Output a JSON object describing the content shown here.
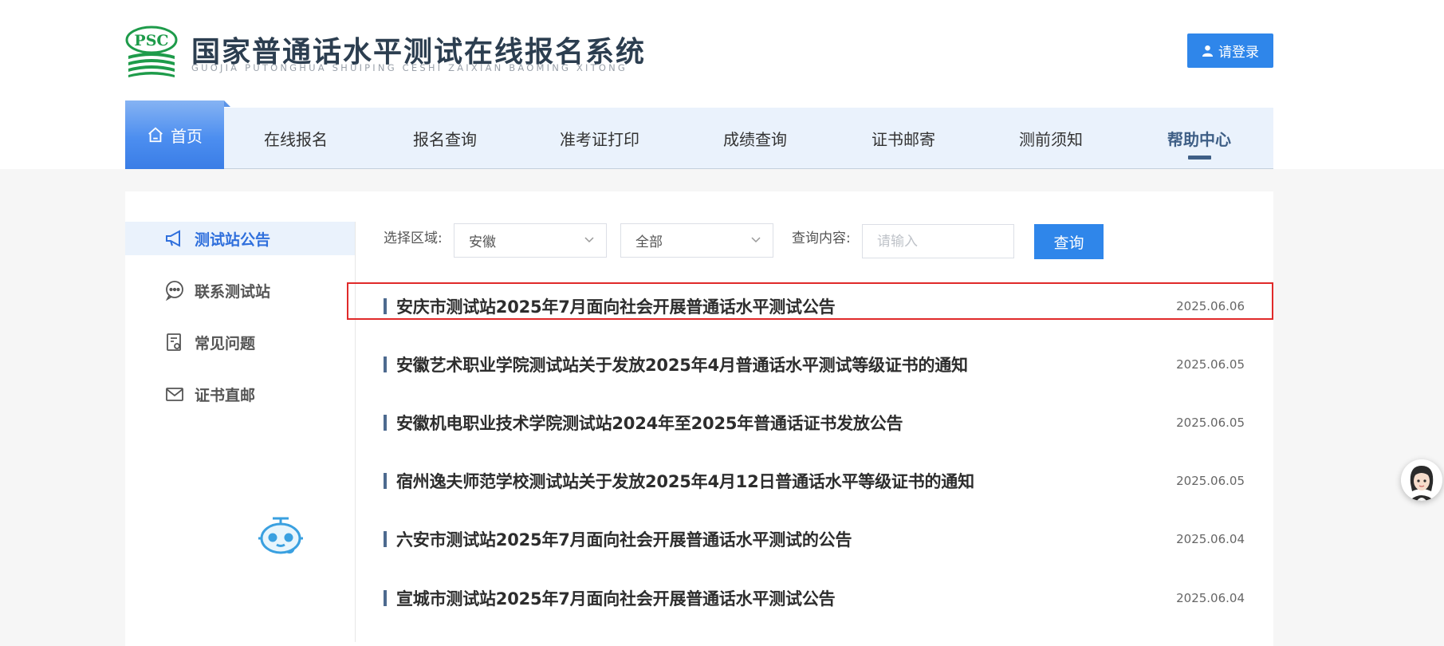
{
  "header": {
    "logo_text": "PSC",
    "title": "国家普通话水平测试在线报名系统",
    "subtitle": "GUOJIA PUTONGHUA SHUIPING CESHI ZAIXIAN BAOMING XITONG",
    "login_label": "请登录"
  },
  "nav": {
    "home": "首页",
    "items": [
      "在线报名",
      "报名查询",
      "准考证打印",
      "成绩查询",
      "证书邮寄",
      "测前须知",
      "帮助中心"
    ]
  },
  "sidebar": {
    "items": [
      {
        "label": "测试站公告",
        "icon": "megaphone-icon"
      },
      {
        "label": "联系测试站",
        "icon": "chat-icon"
      },
      {
        "label": "常见问题",
        "icon": "document-icon"
      },
      {
        "label": "证书直邮",
        "icon": "mail-icon"
      }
    ]
  },
  "filters": {
    "region_label": "选择区域:",
    "province": "安徽",
    "city": "全部",
    "query_label": "查询内容:",
    "query_placeholder": "请输入",
    "query_button": "查询"
  },
  "announcements": [
    {
      "title": "安庆市测试站2025年7月面向社会开展普通话水平测试公告",
      "date": "2025.06.06"
    },
    {
      "title": "安徽艺术职业学院测试站关于发放2025年4月普通话水平测试等级证书的通知",
      "date": "2025.06.05"
    },
    {
      "title": "安徽机电职业技术学院测试站2024年至2025年普通话证书发放公告",
      "date": "2025.06.05"
    },
    {
      "title": "宿州逸夫师范学校测试站关于发放2025年4月12日普通话水平等级证书的通知",
      "date": "2025.06.05"
    },
    {
      "title": "六安市测试站2025年7月面向社会开展普通话水平测试的公告",
      "date": "2025.06.04"
    },
    {
      "title": "宣城市测试站2025年7月面向社会开展普通话水平测试公告",
      "date": "2025.06.04"
    }
  ],
  "colors": {
    "primary": "#2f86ea",
    "nav_bg": "#eaf2fc",
    "active_text": "#2f6fdc",
    "highlight": "#e02a2a",
    "logo_green": "#1e9b4a"
  }
}
